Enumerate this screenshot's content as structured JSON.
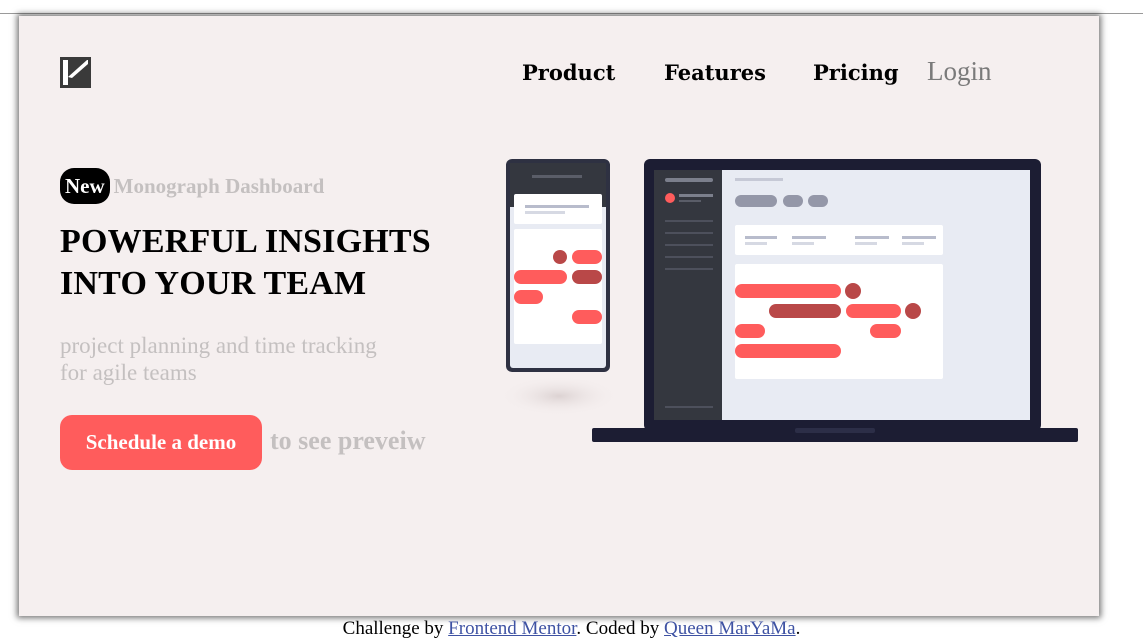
{
  "brand": {
    "logo_icon": "k-logo-icon"
  },
  "nav": {
    "links": [
      "Product",
      "Features",
      "Pricing"
    ],
    "login_label": "Login"
  },
  "hero": {
    "badge_new": "New",
    "badge_text": "Monograph Dashboard",
    "headline_line1": "POWERFUL INSIGHTS",
    "headline_line2": "INTO YOUR TEAM",
    "sub_line1": "project planning and time tracking",
    "sub_line2": "for agile teams",
    "cta_label": "Schedule a demo",
    "cta_after": "to see preveiw"
  },
  "colors": {
    "background": "#f5efef",
    "accent": "#ff5c5c",
    "accent_dark": "#b94848",
    "muted_text": "#c4c0c0",
    "device_dark": "#1c1d33"
  },
  "illustration": {
    "name": "dashboard-devices-illustration"
  },
  "footer": {
    "prefix": "Challenge by",
    "link1": "Frontend Mentor",
    "middle": ". Coded by",
    "link2": "Queen MarYaMa",
    "suffix": "."
  }
}
